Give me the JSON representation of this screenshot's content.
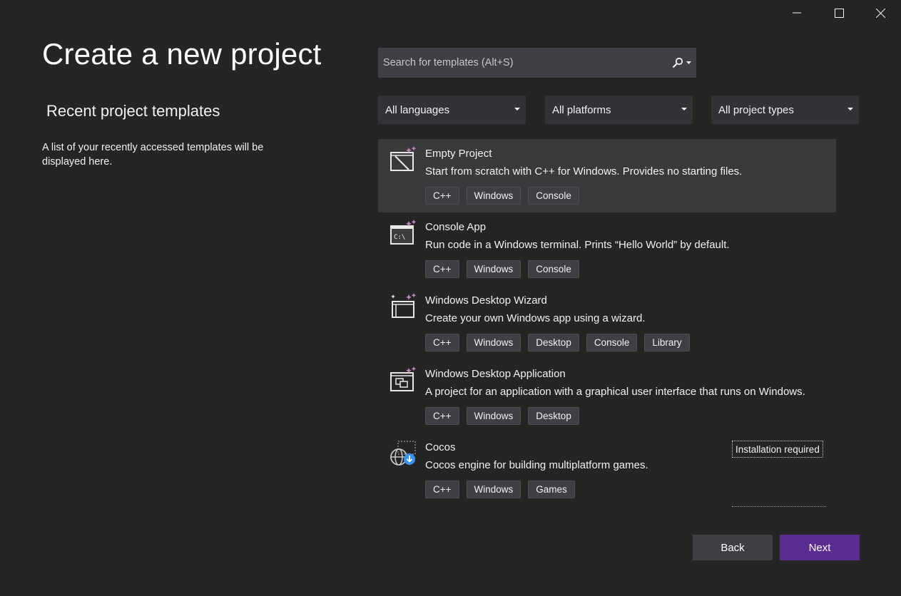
{
  "window": {
    "minimize_icon": "minimize-icon",
    "maximize_icon": "maximize-icon",
    "close_icon": "close-icon"
  },
  "page_title": "Create a new project",
  "recent": {
    "title": "Recent project templates",
    "description": "A list of your recently accessed templates will be displayed here."
  },
  "search": {
    "placeholder": "Search for templates (Alt+S)",
    "value": "",
    "icon": "search-icon"
  },
  "filters": {
    "language": "All languages",
    "platform": "All platforms",
    "project_type": "All project types"
  },
  "templates": [
    {
      "name": "Empty Project",
      "description": "Start from scratch with C++ for Windows. Provides no starting files.",
      "tags": [
        "C++",
        "Windows",
        "Console"
      ],
      "icon": "empty-project-icon",
      "selected": true
    },
    {
      "name": "Console App",
      "description": "Run code in a Windows terminal. Prints “Hello World” by default.",
      "tags": [
        "C++",
        "Windows",
        "Console"
      ],
      "icon": "console-app-icon"
    },
    {
      "name": "Windows Desktop Wizard",
      "description": "Create your own Windows app using a wizard.",
      "tags": [
        "C++",
        "Windows",
        "Desktop",
        "Console",
        "Library"
      ],
      "icon": "desktop-wizard-icon"
    },
    {
      "name": "Windows Desktop Application",
      "description": "A project for an application with a graphical user interface that runs on Windows.",
      "tags": [
        "C++",
        "Windows",
        "Desktop"
      ],
      "icon": "desktop-application-icon"
    },
    {
      "name": "Cocos",
      "description": "Cocos engine for building multiplatform games.",
      "tags": [
        "C++",
        "Windows",
        "Games"
      ],
      "badge": "Installation required",
      "icon": "cocos-icon"
    }
  ],
  "buttons": {
    "back": "Back",
    "next": "Next"
  },
  "colors": {
    "background": "#252526",
    "accent": "#5c2d91",
    "selected_row": "#3a3a3d",
    "sparkle": "#c586c0"
  }
}
